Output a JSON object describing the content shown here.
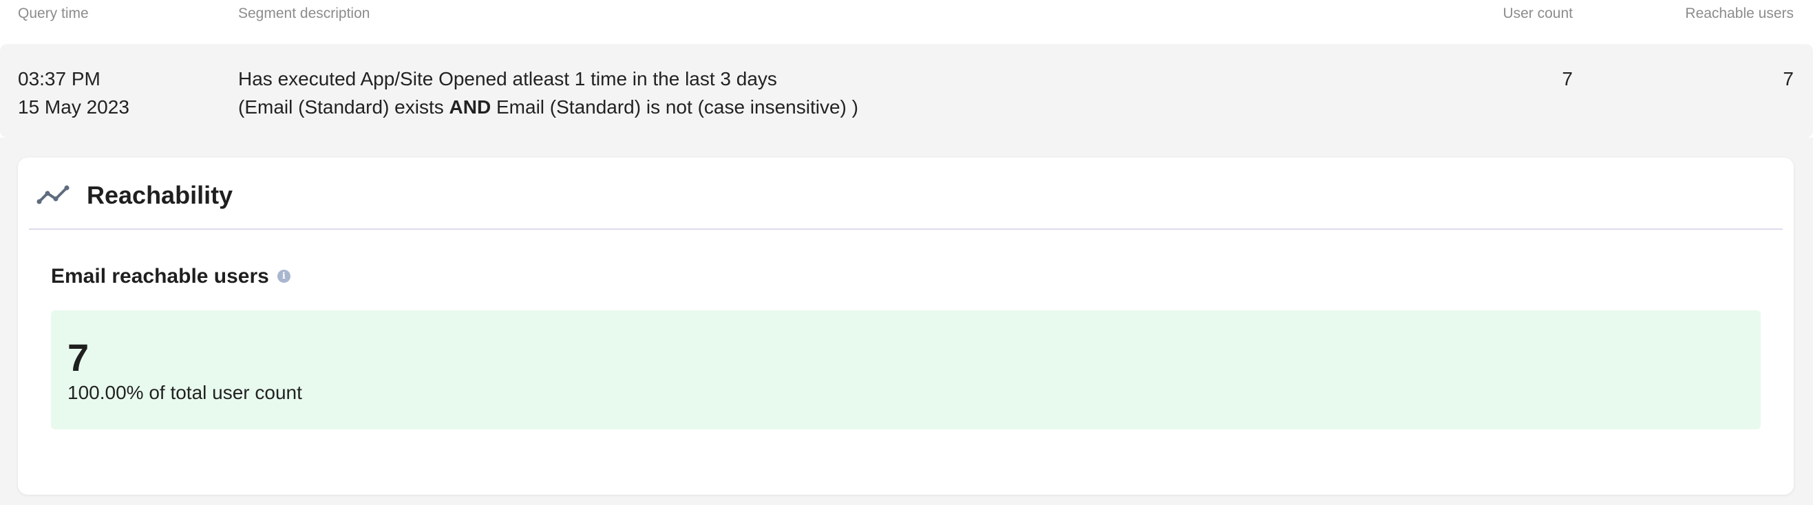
{
  "table": {
    "headers": {
      "query_time": "Query time",
      "segment_description": "Segment description",
      "user_count": "User count",
      "reachable_users": "Reachable users"
    },
    "row": {
      "time": "03:37 PM",
      "date": "15 May 2023",
      "segment_line1": "Has executed App/Site Opened atleast 1 time in the last 3 days",
      "segment_line2_part1": "(Email (Standard) exists ",
      "segment_line2_operator": "AND",
      "segment_line2_part2": " Email (Standard) is not (case insensitive) )",
      "user_count": "7",
      "reachable_users": "7"
    }
  },
  "reachability": {
    "title": "Reachability",
    "icon": "trend-line-icon",
    "metric": {
      "label": "Email reachable users",
      "info_icon": "info-icon",
      "value": "7",
      "subtext": "100.00% of total user count"
    }
  },
  "colors": {
    "row_background": "#f4f4f4",
    "metric_background": "#e8faee",
    "header_text": "#8c8c8c",
    "icon": "#5f6b7e"
  }
}
